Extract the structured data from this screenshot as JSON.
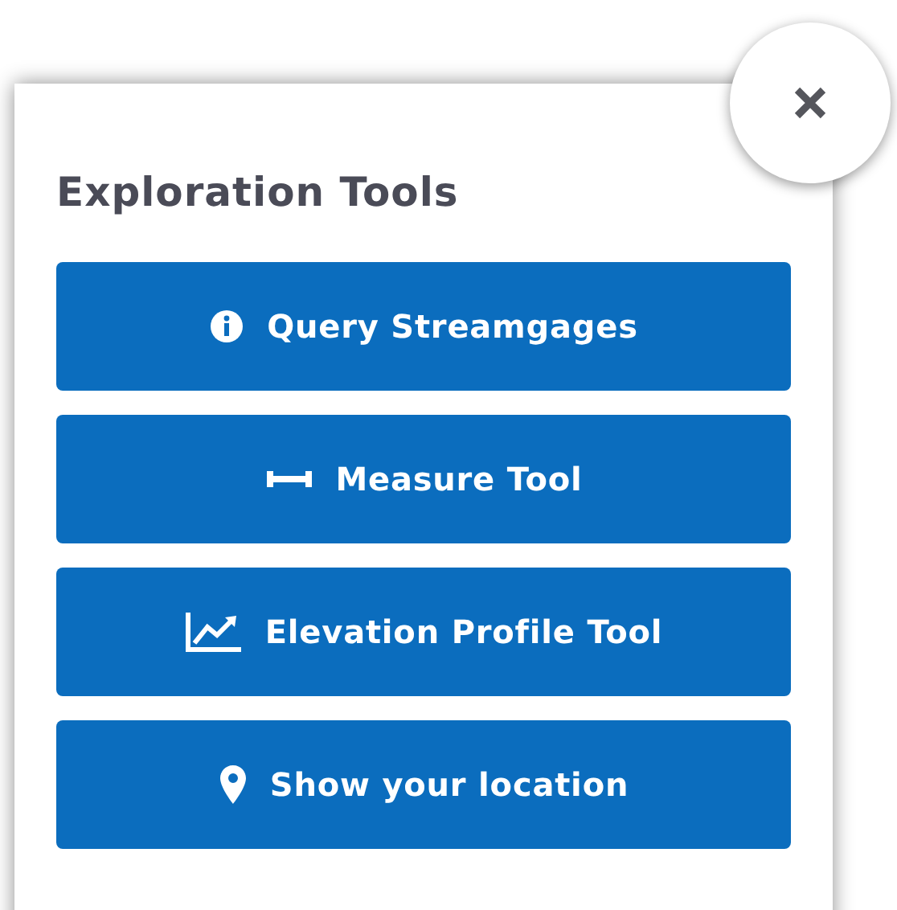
{
  "panel": {
    "title": "Exploration Tools",
    "tools": [
      {
        "kind": "info",
        "label": "Query Streamgages"
      },
      {
        "kind": "measure",
        "label": "Measure Tool"
      },
      {
        "kind": "chart",
        "label": "Elevation Profile Tool"
      },
      {
        "kind": "location",
        "label": "Show your location"
      }
    ]
  }
}
